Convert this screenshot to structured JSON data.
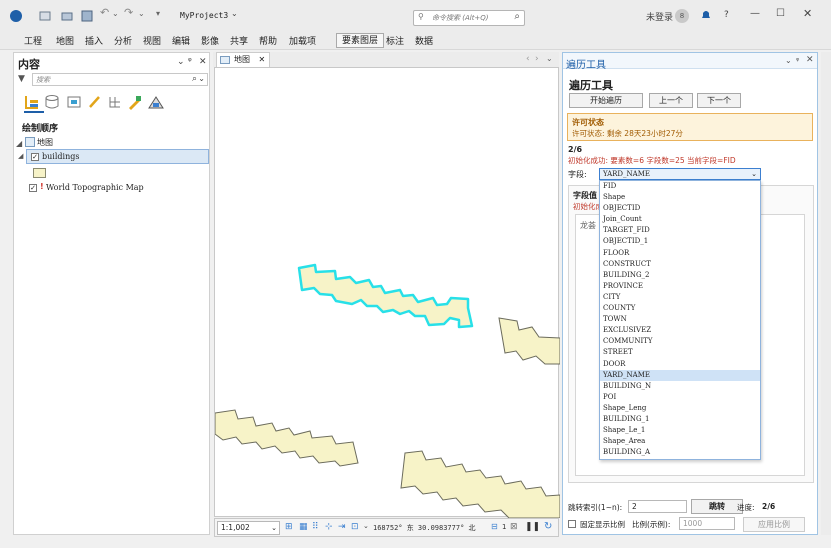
{
  "title_bar": {
    "project": "MyProject3",
    "command_search_placeholder": "命令搜索 (Alt+Q)",
    "user": "未登录",
    "user_initial": "8",
    "help": "?"
  },
  "ribbon_tabs": [
    "工程",
    "地图",
    "插入",
    "分析",
    "视图",
    "编辑",
    "影像",
    "共享",
    "帮助",
    "加载项"
  ],
  "ribbon_context_tabs": [
    "要素图层",
    "标注",
    "数据"
  ],
  "contents": {
    "title": "内容",
    "search_placeholder": "搜索",
    "section": "绘制顺序",
    "map_name": "地图",
    "layers": [
      {
        "name": "buildings",
        "checked": true
      },
      {
        "name": "World Topographic Map",
        "checked": true,
        "warning": true
      }
    ]
  },
  "map_view": {
    "tab_label": "地图",
    "scale": "1:1,002",
    "coordinates": "168752° 东 30.0983777° 北",
    "selected_count": "1"
  },
  "traverse_tool": {
    "tab_label": "遍历工具",
    "title": "遍历工具",
    "buttons": {
      "start": "开始遍历",
      "prev": "上一个",
      "next": "下一个"
    },
    "license": {
      "title": "许可状态",
      "text": "许可状态: 剩余 28天23小时27分"
    },
    "progress": "2/6",
    "init_message": "初始化成功: 要素数=6 字段数=25 当前字段=FID",
    "field_label": "字段:",
    "field_value": "YARD_NAME",
    "field_options": [
      "FID",
      "Shape",
      "OBJECTID",
      "Join_Count",
      "TARGET_FID",
      "OBJECTID_1",
      "FLOOR",
      "CONSTRUCT",
      "BUILDING_2",
      "PROVINCE",
      "CITY",
      "COUNTY",
      "TOWN",
      "EXCLUSIVEZ",
      "COMMUNITY",
      "STREET",
      "DOOR",
      "YARD_NAME",
      "BUILDING_N",
      "POI",
      "Shape_Leng",
      "BUILDING_1",
      "Shape_Le_1",
      "Shape_Area",
      "BUILDING_A"
    ],
    "field_panel_title": "字段值",
    "field_panel_sub": "初始化成",
    "field_panel_content": "龙荟",
    "jump_label": "跳转索引(1~n):",
    "jump_value": "2",
    "jump_button": "跳转",
    "progress_label": "进度:",
    "progress_value": "2/6",
    "fixed_scale_label": "固定显示比例",
    "scale_label": "比例(示例):",
    "scale_value": "1000",
    "apply_scale": "应用比例"
  },
  "colors": {
    "selection": "#28e0e8",
    "building_fill": "#f7f3c8",
    "building_stroke": "#6b6b5c",
    "accent": "#1e5fa8"
  }
}
